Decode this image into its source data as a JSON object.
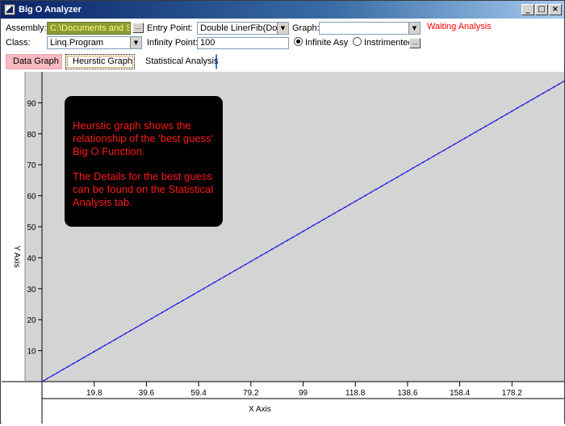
{
  "window": {
    "title": "Big O Analyzer"
  },
  "form": {
    "assembly_label": "Assembly:",
    "assembly_value": "C:\\Documents and Settin",
    "assembly_btn": "...",
    "class_label": "Class:",
    "class_value": "Linq.Program",
    "entry_label": "Entry Point:",
    "entry_value": "Double LinerFib(Double",
    "infinity_label": "Infinity Point:",
    "infinity_value": "100",
    "graph_label": "Graph:",
    "graph_value": "",
    "status": "Waiting Analysis",
    "radio_infinite_label": "Infinite Asy",
    "radio_instrumented_label": "Instrimented",
    "instr_btn": "..."
  },
  "tabs": [
    {
      "label": "Data Graph"
    },
    {
      "label": "Heurstic Graph"
    },
    {
      "label": "Statistical Analysis"
    }
  ],
  "note": {
    "line1": "Heurstic graph shows the",
    "line2": "relationship of the 'best guess'",
    "line3": "Big O Function.",
    "line4": "The Details for the best guess",
    "line5": "can be found on the Statistical",
    "line6": "Analysis tab."
  },
  "colors": {
    "line": "#1f1fe6",
    "note_text": "#ff1a1a",
    "note_bg": "#000000",
    "status": "#ff0000"
  },
  "chart_data": {
    "type": "line",
    "xlabel": "X Axis",
    "ylabel": "Y Axis",
    "x_ticks": [
      "19.8",
      "39.6",
      "59.4",
      "79.2",
      "99",
      "118.8",
      "138.6",
      "158.4",
      "178.2"
    ],
    "y_ticks": [
      "10",
      "20",
      "30",
      "40",
      "50",
      "60",
      "70",
      "80",
      "90"
    ],
    "xlim": [
      0,
      198
    ],
    "ylim": [
      0,
      100
    ],
    "series": [
      {
        "x": [
          0,
          198
        ],
        "y": [
          0,
          97
        ]
      }
    ]
  }
}
